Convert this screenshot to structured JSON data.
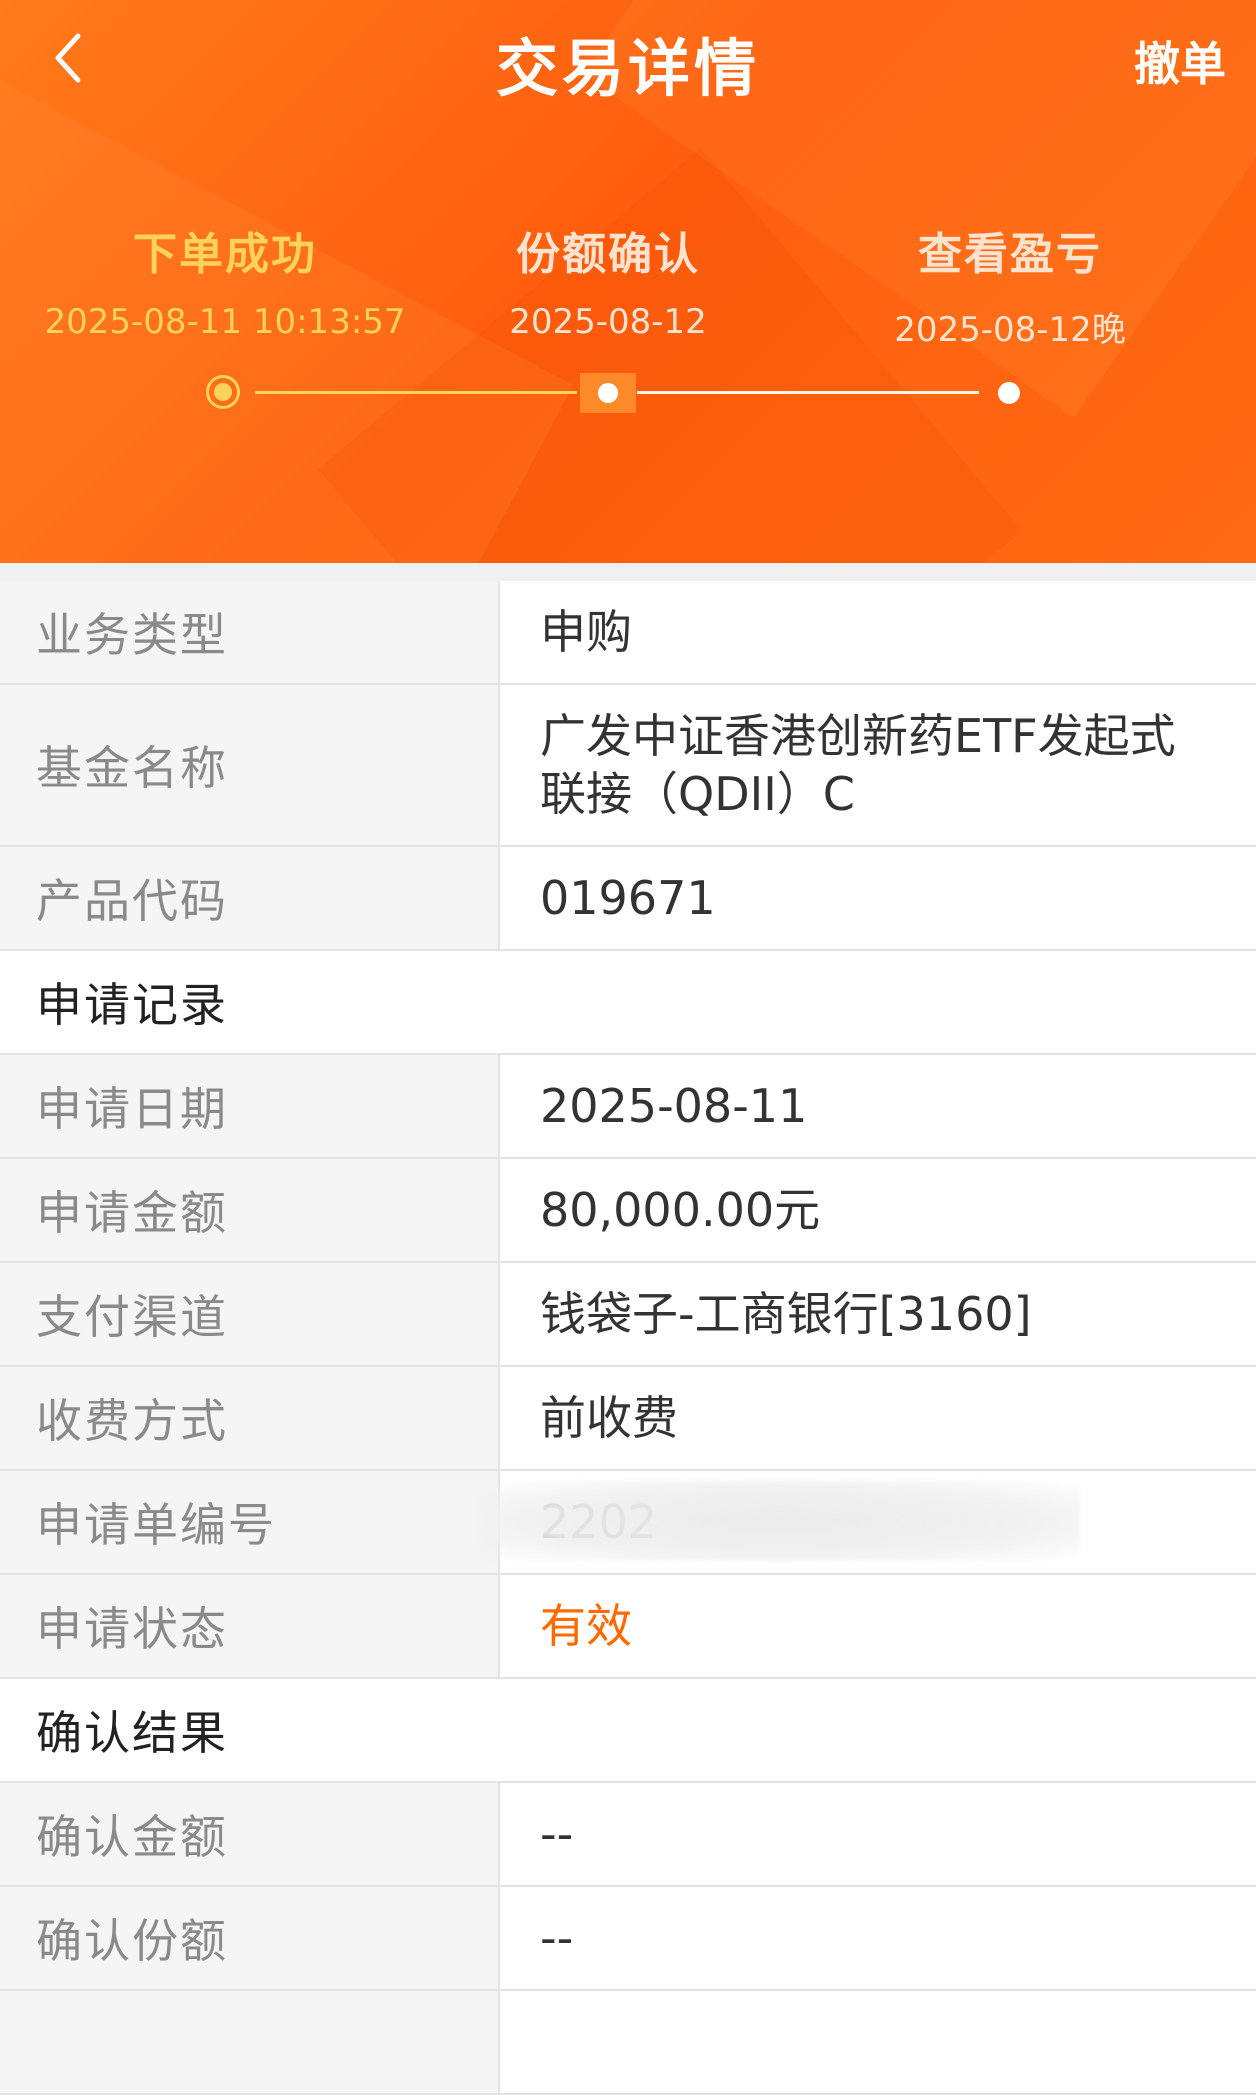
{
  "header": {
    "title": "交易详情",
    "cancel_label": "撤单",
    "back_icon": "chevron-left-icon"
  },
  "steps": [
    {
      "title": "下单成功",
      "time": "2025-08-11 10:13:57",
      "state": "active"
    },
    {
      "title": "份额确认",
      "time": "2025-08-12",
      "state": "pending"
    },
    {
      "title": "查看盈亏",
      "time": "2025-08-12晚",
      "state": "pending"
    }
  ],
  "fund": {
    "type_label": "业务类型",
    "type_value": "申购",
    "name_label": "基金名称",
    "name_value": "广发中证香港创新药ETF发起式联接（QDII）C",
    "code_label": "产品代码",
    "code_value": "019671"
  },
  "application": {
    "section_title": "申请记录",
    "date_label": "申请日期",
    "date_value": "2025-08-11",
    "amount_label": "申请金额",
    "amount_value": "80,000.00元",
    "channel_label": "支付渠道",
    "channel_value": "钱袋子-工商银行[3160]",
    "fee_label": "收费方式",
    "fee_value": "前收费",
    "number_label": "申请单编号",
    "number_value": "2202",
    "status_label": "申请状态",
    "status_value": "有效"
  },
  "confirmation": {
    "section_title": "确认结果",
    "amount_label": "确认金额",
    "amount_value": "--",
    "shares_label": "确认份额",
    "shares_value": "--"
  },
  "colors": {
    "header_orange": "#ff6410",
    "active_yellow": "#ffd35a",
    "status_orange": "#ff6a00"
  }
}
